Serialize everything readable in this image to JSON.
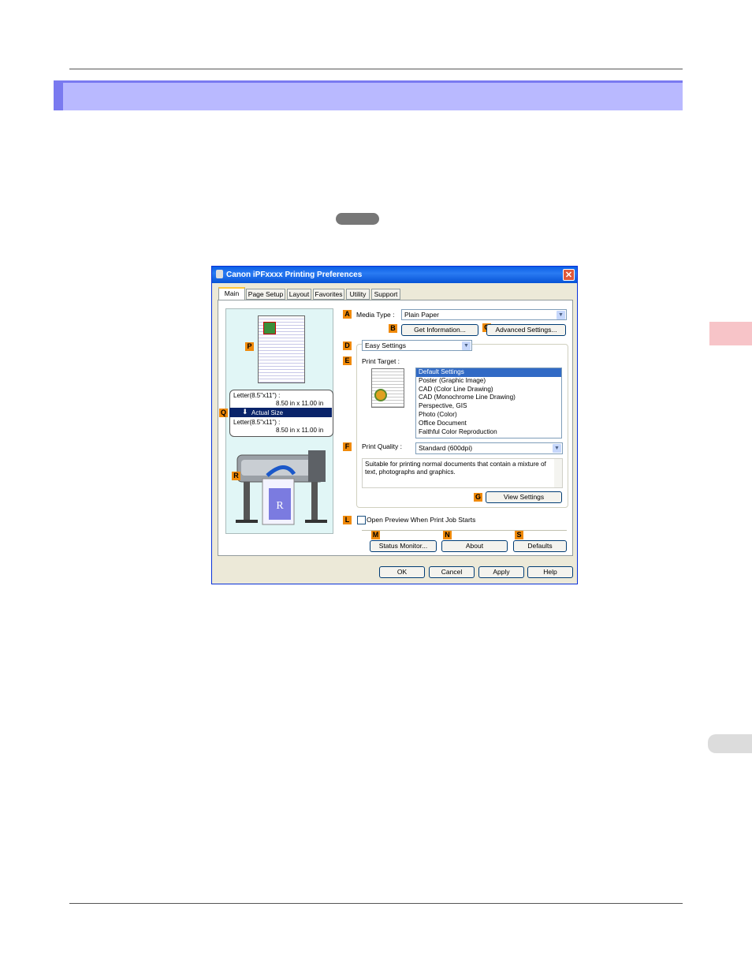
{
  "page": {
    "sidetab_color": "#f7c4c8",
    "banner_color": "#b9b9ff"
  },
  "dialog": {
    "title": "Canon iPFxxxx Printing Preferences",
    "close_glyph": "✕",
    "tabs": [
      "Main",
      "Page Setup",
      "Layout",
      "Favorites",
      "Utility",
      "Support"
    ],
    "active_tab": "Main",
    "media_type": {
      "label": "Media Type :",
      "value": "Plain Paper"
    },
    "get_information": "Get Information...",
    "advanced_settings": "Advanced Settings...",
    "mode": {
      "value": "Easy Settings"
    },
    "print_target": {
      "label": "Print Target :",
      "items": [
        "Default Settings",
        "Poster (Graphic Image)",
        "CAD (Color Line Drawing)",
        "CAD (Monochrome Line Drawing)",
        "Perspective, GIS",
        "Photo (Color)",
        "Office Document",
        "Faithful Color Reproduction"
      ],
      "selected_index": 0
    },
    "print_quality": {
      "label": "Print Quality :",
      "value": "Standard (600dpi)"
    },
    "description": "Suitable for printing normal documents that contain a mixture of text, photographs and graphics.",
    "view_settings": "View Settings",
    "open_preview": {
      "label": "Open Preview When Print Job Starts",
      "checked": false
    },
    "status_monitor": "Status Monitor...",
    "about": "About",
    "defaults": "Defaults",
    "ok": "OK",
    "cancel": "Cancel",
    "apply": "Apply",
    "help": "Help",
    "preview": {
      "paper1": "Letter(8.5\"x11\") :",
      "size1": "8.50 in x 11.00 in",
      "actual_size": "Actual Size",
      "paper2": "Letter(8.5\"x11\") :",
      "size2": "8.50 in x 11.00 in"
    },
    "callouts": {
      "A": "A",
      "B": "B",
      "C": "C",
      "D": "D",
      "E": "E",
      "F": "F",
      "G": "G",
      "L": "L",
      "M": "M",
      "N": "N",
      "S": "S",
      "P": "P",
      "Q": "Q",
      "R": "R"
    }
  }
}
